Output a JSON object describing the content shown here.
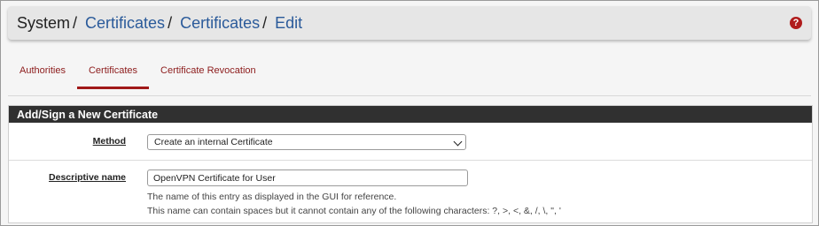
{
  "breadcrumb": {
    "items": [
      "System",
      "Certificates",
      "Certificates",
      "Edit"
    ],
    "separator": "/"
  },
  "help_icon": "question-circle-icon",
  "tabs": [
    {
      "label": "Authorities",
      "active": false
    },
    {
      "label": "Certificates",
      "active": true
    },
    {
      "label": "Certificate Revocation",
      "active": false
    }
  ],
  "panel": {
    "title": "Add/Sign a New Certificate",
    "method": {
      "label": "Method",
      "value": "Create an internal Certificate"
    },
    "descriptive_name": {
      "label": "Descriptive name",
      "value": "OpenVPN Certificate for User",
      "help_line1": "The name of this entry as displayed in the GUI for reference.",
      "help_line2": "This name can contain spaces but it cannot contain any of the following characters: ?, >, <, &, /, \\, \", '"
    }
  },
  "colors": {
    "link": "#2a5a9a",
    "accent": "#a01818",
    "heading_bg": "#303030"
  }
}
